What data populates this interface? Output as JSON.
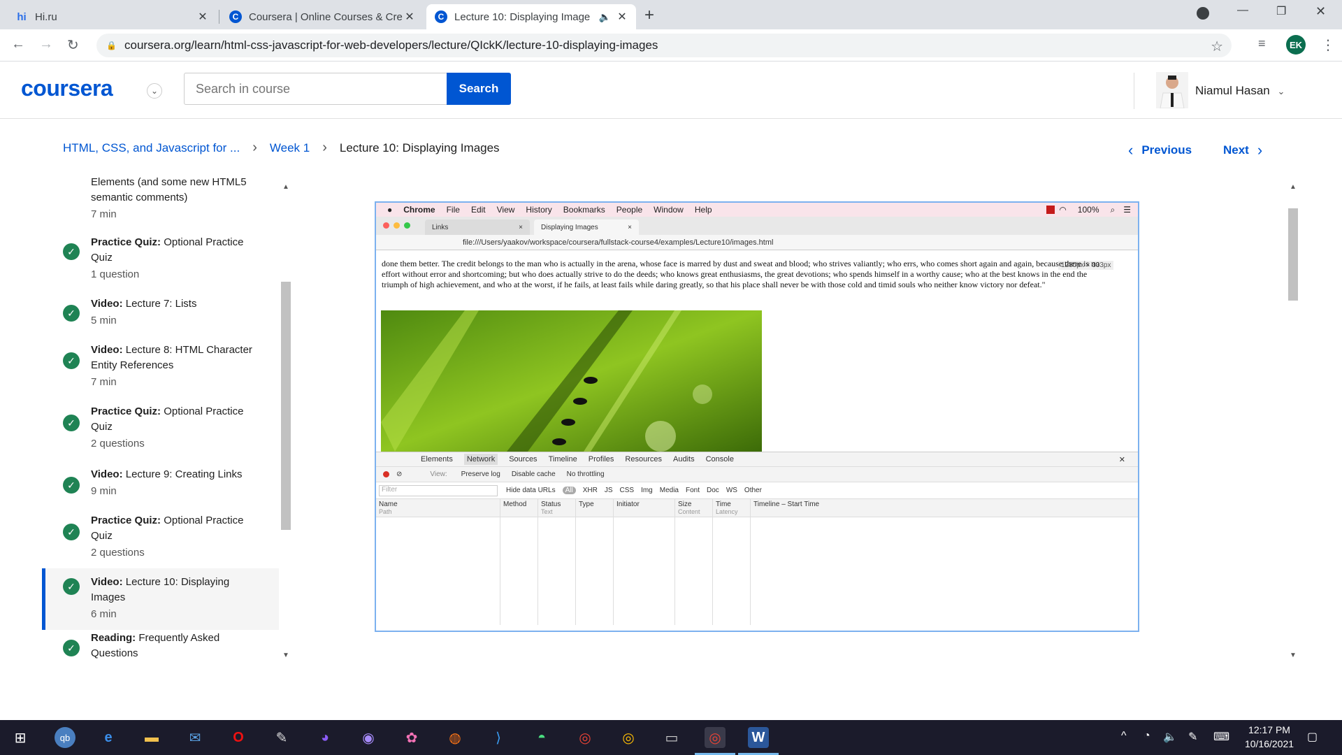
{
  "browser": {
    "tabs": [
      {
        "favicon": "hi",
        "title": "Hi.ru"
      },
      {
        "favicon": "C",
        "title": "Coursera | Online Courses & Cre"
      },
      {
        "favicon": "C",
        "title": "Lecture 10: Displaying Image"
      }
    ],
    "url": "coursera.org/learn/html-css-javascript-for-web-developers/lecture/QIckK/lecture-10-displaying-images",
    "profile_initials": "EK"
  },
  "header": {
    "logo": "coursera",
    "search_placeholder": "Search in course",
    "search_button": "Search",
    "user_name": "Niamul Hasan"
  },
  "breadcrumb": {
    "course": "HTML, CSS, and Javascript for ...",
    "week": "Week 1",
    "current": "Lecture 10: Displaying Images",
    "previous": "Previous",
    "next": "Next"
  },
  "sidebar": {
    "items": [
      {
        "type": "",
        "title": "Elements (and some new HTML5 semantic comments)",
        "meta": "7 min"
      },
      {
        "type": "Practice Quiz:",
        "title": "Optional Practice Quiz",
        "meta": "1 question"
      },
      {
        "type": "Video:",
        "title": "Lecture 7: Lists",
        "meta": "5 min"
      },
      {
        "type": "Video:",
        "title": "Lecture 8: HTML Character Entity References",
        "meta": "7 min"
      },
      {
        "type": "Practice Quiz:",
        "title": "Optional Practice Quiz",
        "meta": "2 questions"
      },
      {
        "type": "Video:",
        "title": "Lecture 9: Creating Links",
        "meta": "9 min"
      },
      {
        "type": "Practice Quiz:",
        "title": "Optional Practice Quiz",
        "meta": "2 questions"
      },
      {
        "type": "Video:",
        "title": "Lecture 10: Displaying Images",
        "meta": "6 min"
      },
      {
        "type": "Reading:",
        "title": "Frequently Asked Questions",
        "meta": ""
      }
    ]
  },
  "video": {
    "mac_menu": [
      "Chrome",
      "File",
      "Edit",
      "View",
      "History",
      "Bookmarks",
      "People",
      "Window",
      "Help"
    ],
    "mac_status": "100%",
    "inner_tabs": [
      "Links",
      "Displaying Images"
    ],
    "inner_url": "file:///Users/yaakov/workspace/coursera/fullstack-course4/examples/Lecture10/images.html",
    "size_badge": "1280px × 333px",
    "quote": "done them better. The credit belongs to the man who is actually in the arena, whose face is marred by dust and sweat and blood; who strives valiantly; who errs, who comes short again and again, because there is no effort without error and shortcoming; but who does actually strive to do the deeds; who knows great enthusiasms, the great devotions; who spends himself in a worthy cause; who at the best knows in the end the triumph of high achievement, and who at the worst, if he fails, at least fails while daring greatly, so that his place shall never be with those cold and timid souls who neither know victory nor defeat.\"",
    "devtools_tabs": [
      "Elements",
      "Network",
      "Sources",
      "Timeline",
      "Profiles",
      "Resources",
      "Audits",
      "Console"
    ],
    "devtools_bar": {
      "view": "View:",
      "preserve": "Preserve log",
      "disable_cache": "Disable cache",
      "throttle": "No throttling"
    },
    "filter": {
      "placeholder": "Filter",
      "hide": "Hide data URLs",
      "types": [
        "All",
        "XHR",
        "JS",
        "CSS",
        "Img",
        "Media",
        "Font",
        "Doc",
        "WS",
        "Other"
      ]
    },
    "columns": [
      {
        "name": "Name",
        "sub": "Path"
      },
      {
        "name": "Method",
        "sub": ""
      },
      {
        "name": "Status",
        "sub": "Text"
      },
      {
        "name": "Type",
        "sub": ""
      },
      {
        "name": "Initiator",
        "sub": ""
      },
      {
        "name": "Size",
        "sub": "Content"
      },
      {
        "name": "Time",
        "sub": "Latency"
      },
      {
        "name": "Timeline – Start Time",
        "sub": ""
      }
    ]
  },
  "taskbar": {
    "time": "12:17 PM",
    "date": "10/16/2021"
  },
  "colors": {
    "brand": "#0056d2",
    "check": "#1f8354"
  }
}
